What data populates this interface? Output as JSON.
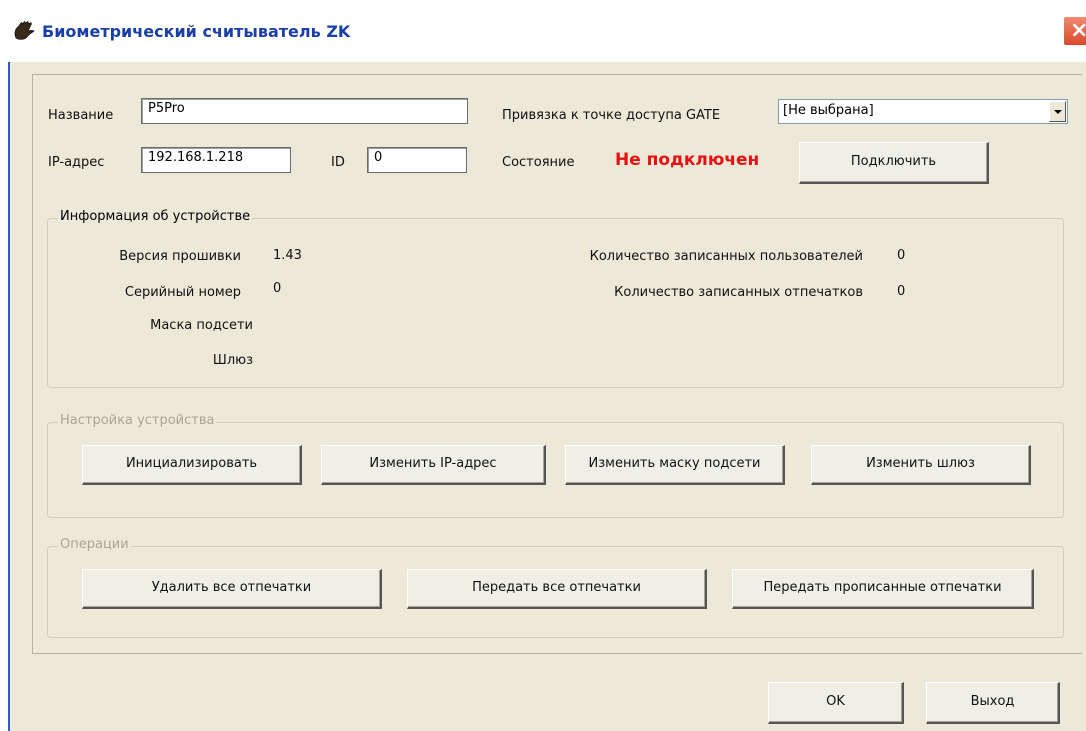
{
  "window": {
    "title": "Биометрический считыватель ZK",
    "app_icon": "hand-fingerprint-icon",
    "close_icon": "close-icon",
    "close_symbol": "×"
  },
  "form": {
    "name_label": "Название",
    "name_value": "P5Pro",
    "ip_label": "IP-адрес",
    "ip_value": "192.168.1.218",
    "id_label": "ID",
    "id_value": "0",
    "gate_label": "Привязка к точке доступа GATE",
    "gate_value": "[Не выбрана]",
    "state_label": "Состояние",
    "state_value": "Не подключен",
    "connect_button": "Подключить"
  },
  "device_info": {
    "title": "Информация об устройстве",
    "firmware_label": "Версия прошивки",
    "firmware_value": "1.43",
    "serial_label": "Серийный номер",
    "serial_value": "0",
    "mask_label": "Маска подсети",
    "mask_value": "",
    "gateway_label": "Шлюз",
    "gateway_value": "",
    "users_label": "Количество записанных пользователей",
    "users_value": "0",
    "prints_label": "Количество записанных отпечатков",
    "prints_value": "0"
  },
  "device_settings": {
    "title": "Настройка устройства",
    "buttons": [
      "Инициализировать",
      "Изменить IP-адрес",
      "Изменить маску подсети",
      "Изменить шлюз"
    ]
  },
  "operations": {
    "title": "Операции",
    "buttons": [
      "Удалить все отпечатки",
      "Передать все отпечатки",
      "Передать прописанные отпечатки"
    ]
  },
  "footer": {
    "ok_button": "OK",
    "exit_button": "Выход"
  },
  "colors": {
    "title_text": "#1b3fa8",
    "status_error": "#e81010",
    "dialog_face": "#ece9d8",
    "disabled_text": "#a8a597"
  }
}
